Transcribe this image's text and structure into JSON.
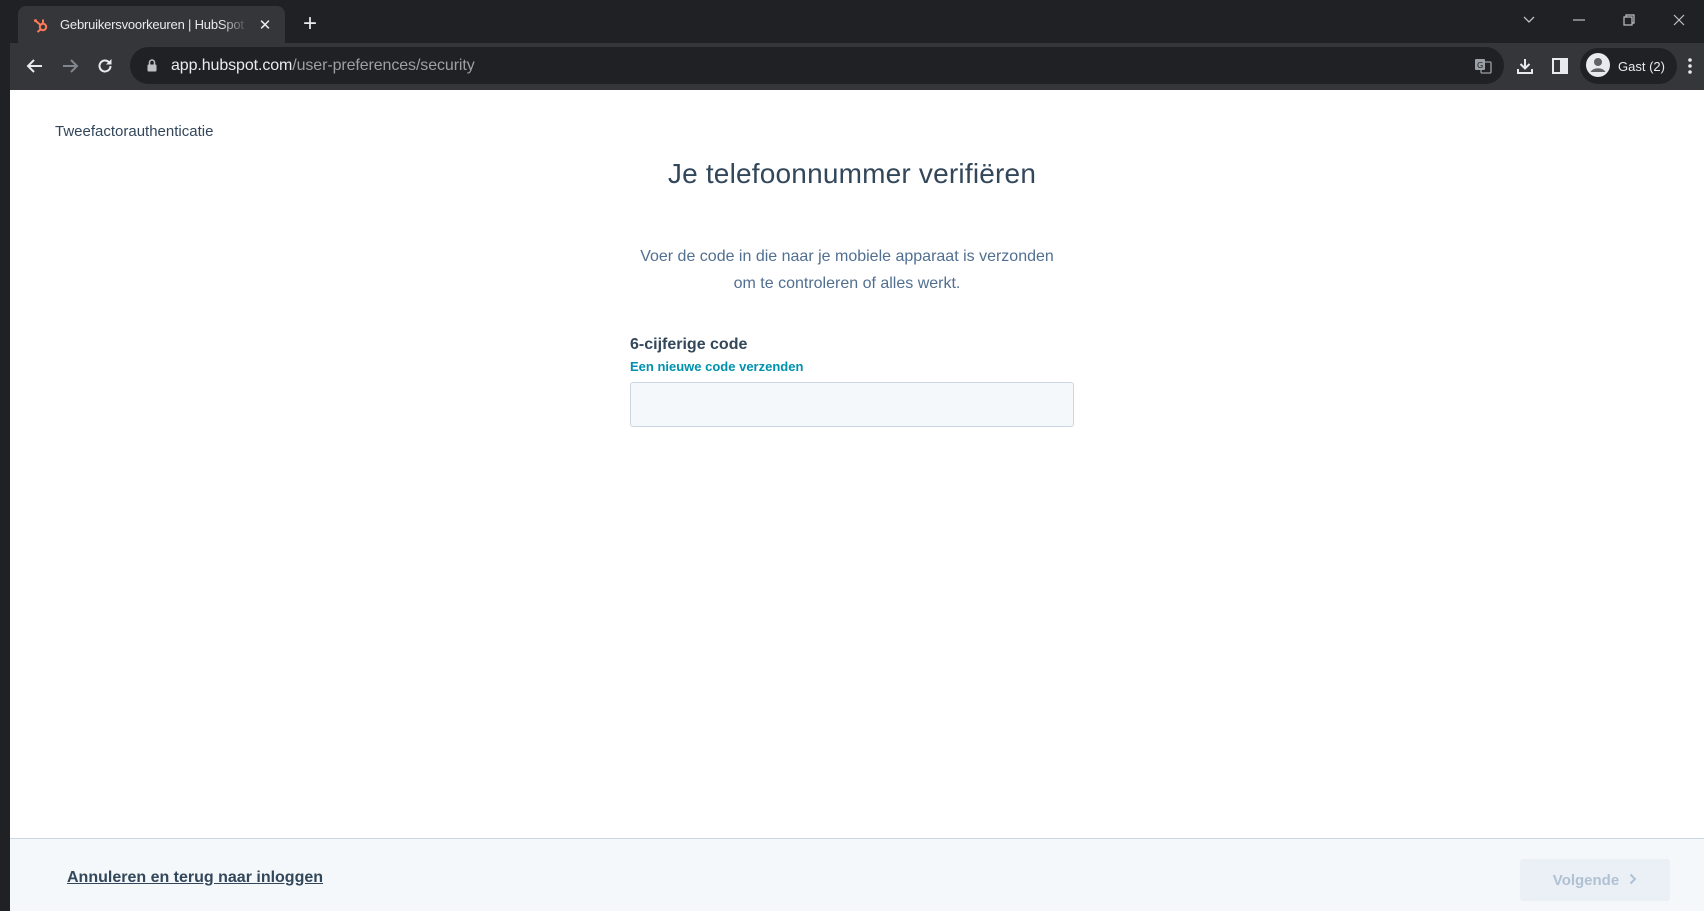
{
  "browser": {
    "tab_title": "Gebruikersvoorkeuren | HubSpot",
    "url_host": "app.hubspot.com",
    "url_path": "/user-preferences/security",
    "profile_label": "Gast (2)"
  },
  "page": {
    "breadcrumb": "Tweefactorauthenticatie",
    "heading": "Je telefoonnummer verifiëren",
    "description_line1": "Voer de code in die naar je mobiele apparaat is verzonden",
    "description_line2": "om te controleren of alles werkt.",
    "code_field": {
      "label": "6-cijferige code",
      "resend_link": "Een nieuwe code verzenden",
      "value": "",
      "placeholder": ""
    }
  },
  "footer": {
    "cancel_link": "Annuleren en terug naar inloggen",
    "next_button": "Volgende"
  },
  "colors": {
    "brand_orange": "#ff7a59",
    "text_primary": "#33475b",
    "link_teal": "#0091ae",
    "disabled_button_bg": "#eaf0f6"
  },
  "icons": {
    "tab_favicon": "hubspot-logo-icon",
    "back": "arrow-left-icon",
    "forward": "arrow-right-icon",
    "reload": "reload-icon",
    "lock": "lock-icon",
    "translate": "translate-icon",
    "download": "download-icon",
    "side_panel": "side-panel-icon",
    "profile": "profile-avatar-icon",
    "menu": "kebab-menu-icon",
    "next_chevron": "chevron-right-icon"
  }
}
